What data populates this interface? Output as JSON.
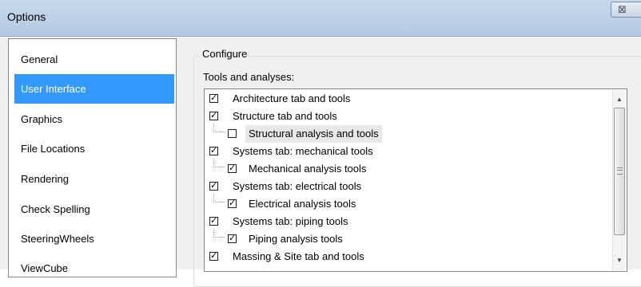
{
  "window": {
    "title": "Options",
    "close_glyph": "⊠"
  },
  "sidebar": {
    "items": [
      {
        "label": "General"
      },
      {
        "label": "User Interface",
        "selected": true
      },
      {
        "label": "Graphics"
      },
      {
        "label": "File Locations"
      },
      {
        "label": "Rendering"
      },
      {
        "label": "Check Spelling"
      },
      {
        "label": "SteeringWheels"
      },
      {
        "label": "ViewCube"
      }
    ]
  },
  "configure": {
    "group_title": "Configure",
    "tools_label": "Tools and analyses:",
    "items": [
      {
        "label": "Architecture tab and tools",
        "checked": true,
        "child": false
      },
      {
        "label": "Structure tab and tools",
        "checked": true,
        "child": false
      },
      {
        "label": "Structural analysis and tools",
        "checked": false,
        "child": true
      },
      {
        "label": "Systems tab: mechanical tools",
        "checked": true,
        "child": false
      },
      {
        "label": "Mechanical analysis tools",
        "checked": true,
        "child": true
      },
      {
        "label": "Systems tab: electrical tools",
        "checked": true,
        "child": false
      },
      {
        "label": "Electrical analysis tools",
        "checked": true,
        "child": true
      },
      {
        "label": "Systems tab: piping tools",
        "checked": true,
        "child": false
      },
      {
        "label": "Piping analysis tools",
        "checked": true,
        "child": true
      },
      {
        "label": "Massing & Site tab and tools",
        "checked": true,
        "child": false
      }
    ]
  },
  "scrollbar": {
    "up_glyph": "▲",
    "down_glyph": "▼"
  },
  "colors": {
    "selection": "#3399ff",
    "titlebar": "#b9cde5"
  }
}
